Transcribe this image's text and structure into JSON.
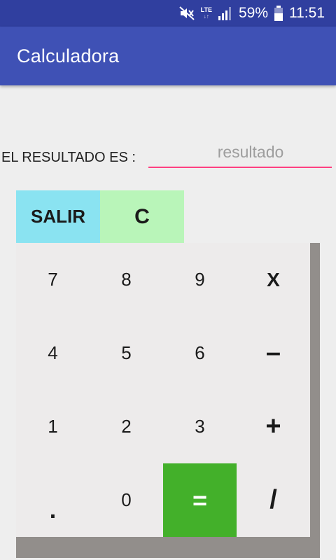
{
  "status_bar": {
    "network": "LTE",
    "battery_percent": "59%",
    "time": "11:51",
    "icons": [
      "mute-icon",
      "lte-icon",
      "signal-icon",
      "battery-icon"
    ]
  },
  "app_bar": {
    "title": "Calculadora"
  },
  "result": {
    "label": "EL RESULTADO ES :",
    "placeholder": "resultado",
    "value": ""
  },
  "buttons": {
    "salir": "SALIR",
    "clear": "C"
  },
  "keypad": {
    "k7": "7",
    "k8": "8",
    "k9": "9",
    "mul": "X",
    "k4": "4",
    "k5": "5",
    "k6": "6",
    "sub": "–",
    "k1": "1",
    "k2": "2",
    "k3": "3",
    "add": "+",
    "dot": ".",
    "k0": "0",
    "eq": "=",
    "div": "/"
  },
  "colors": {
    "status_bar": "#303f9f",
    "app_bar": "#3f51b5",
    "input_underline": "#ff4081",
    "salir_button": "#8ae3f1",
    "clear_button": "#b9f5b9",
    "equals_button": "#43b02a",
    "keypad_bg": "#edebeb",
    "keypad_shadow": "#928e8b"
  }
}
